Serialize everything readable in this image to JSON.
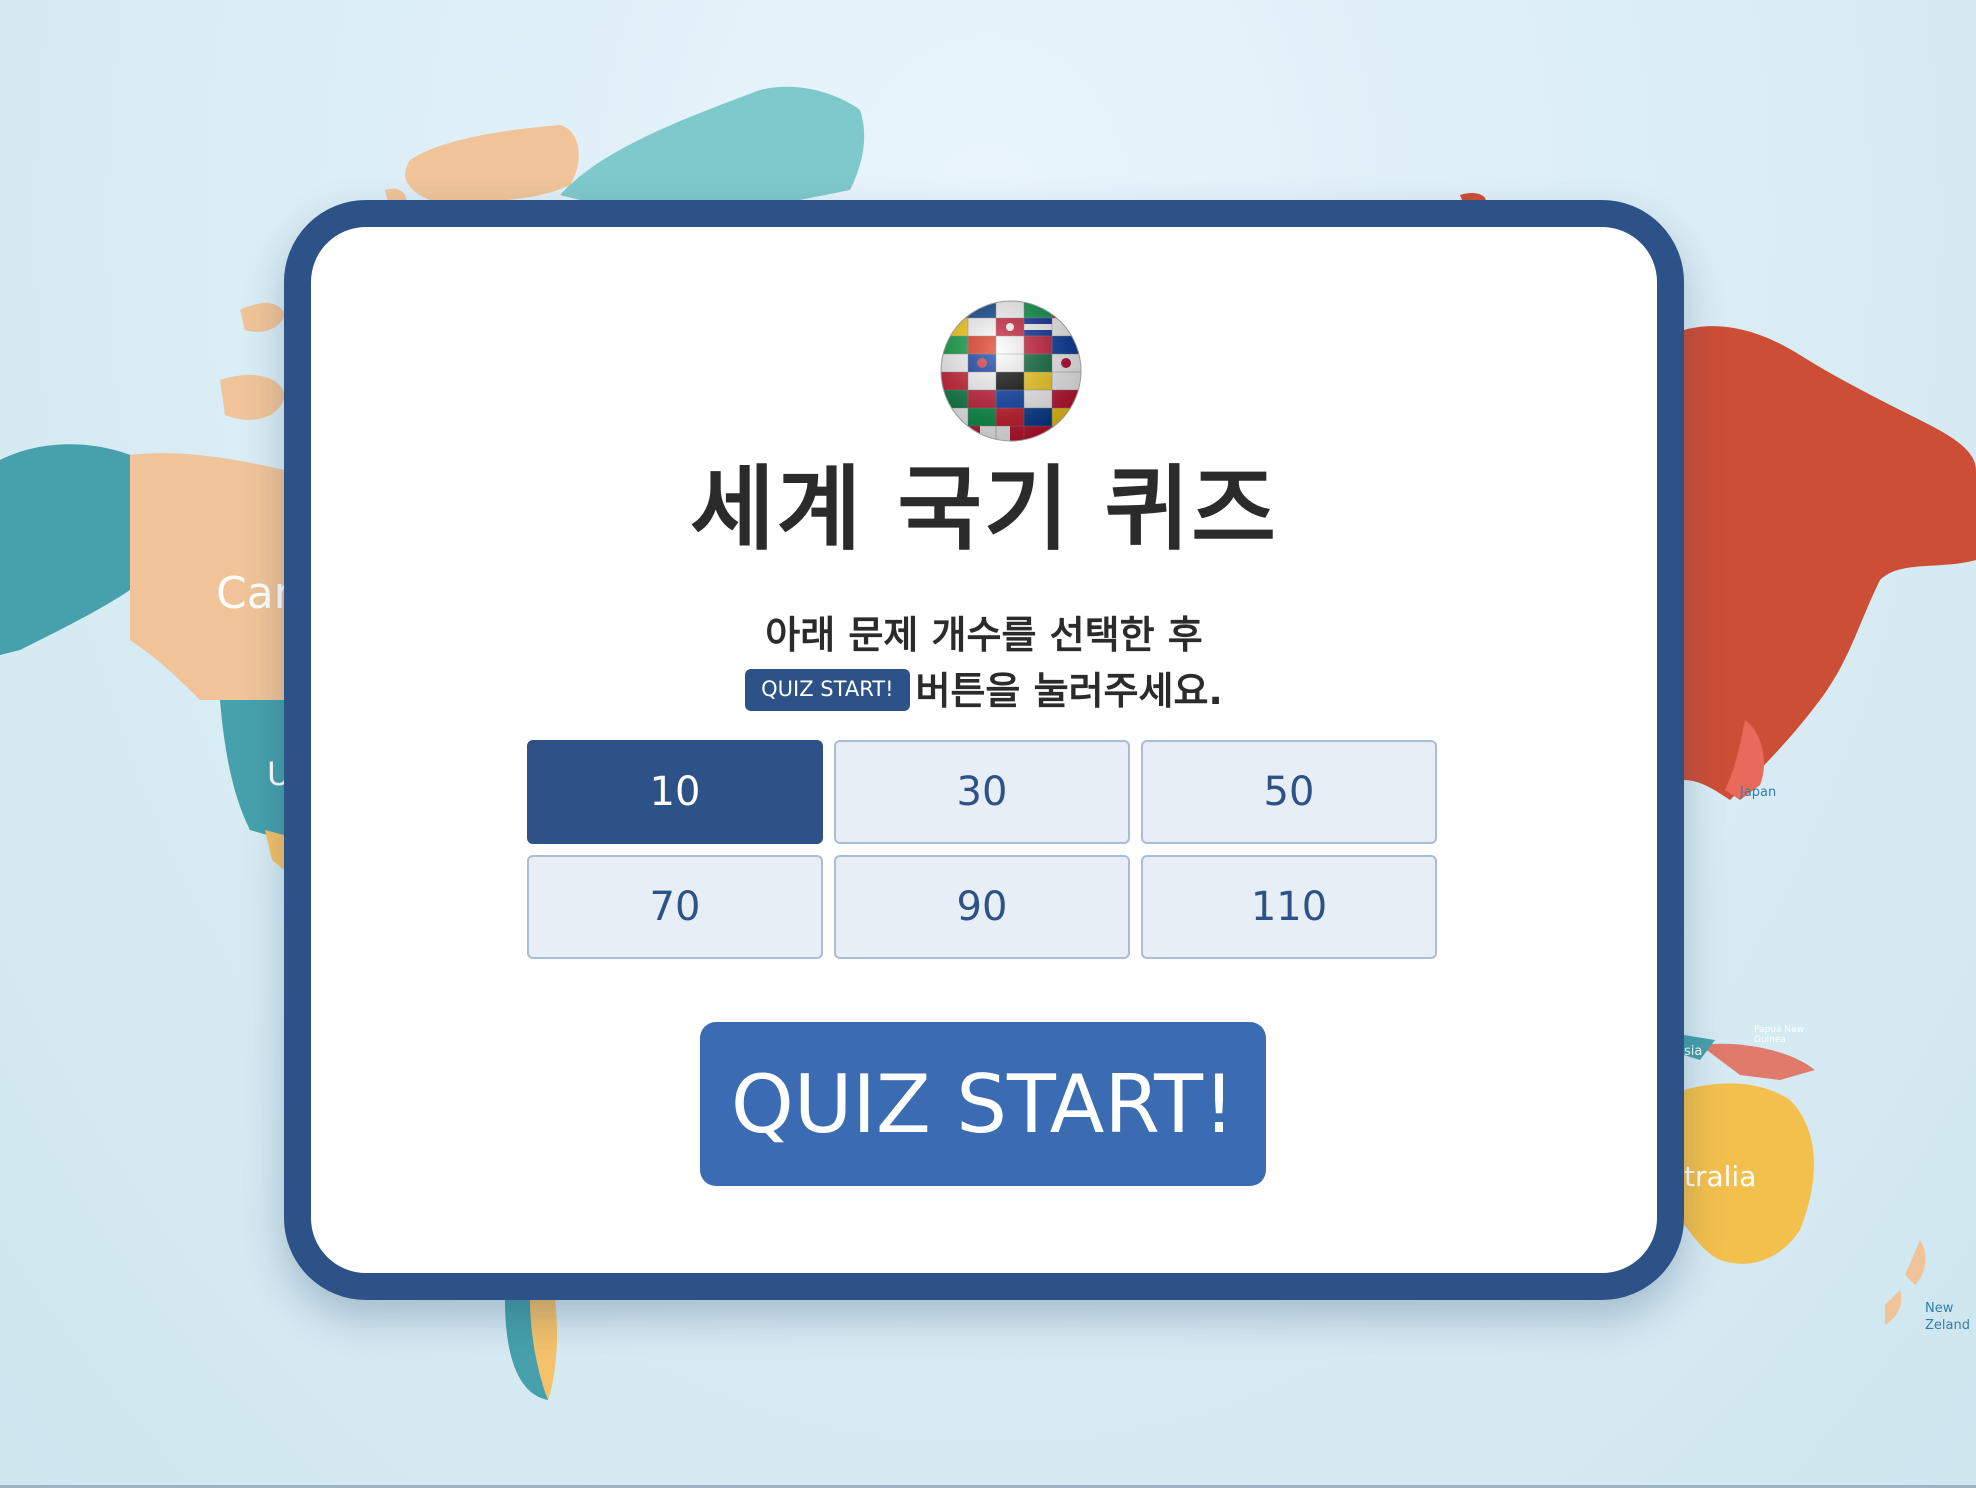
{
  "background": {
    "map_labels": {
      "canada": "Can",
      "usa": "U",
      "japan": "Japan",
      "papua_new_guinea": "Papua New Guinea",
      "indonesia": "sia",
      "australia": "tralia",
      "new_zealand": "New Zeland"
    }
  },
  "card": {
    "title": "세계 국기 퀴즈",
    "instruction_line1": "아래 문제 개수를 선택한 후",
    "instruction_badge": "QUIZ START!",
    "instruction_line2": "버튼을 눌러주세요.",
    "count_options": [
      "10",
      "30",
      "50",
      "70",
      "90",
      "110"
    ],
    "selected_count": "10",
    "start_button_label": "QUIZ START!"
  },
  "colors": {
    "brand_dark_blue": "#2d5287",
    "start_button_blue": "#3b6cb3",
    "option_bg": "#e7eef5",
    "option_border": "#a9bdd4"
  },
  "icons": {
    "logo": "flag-globe-icon"
  }
}
